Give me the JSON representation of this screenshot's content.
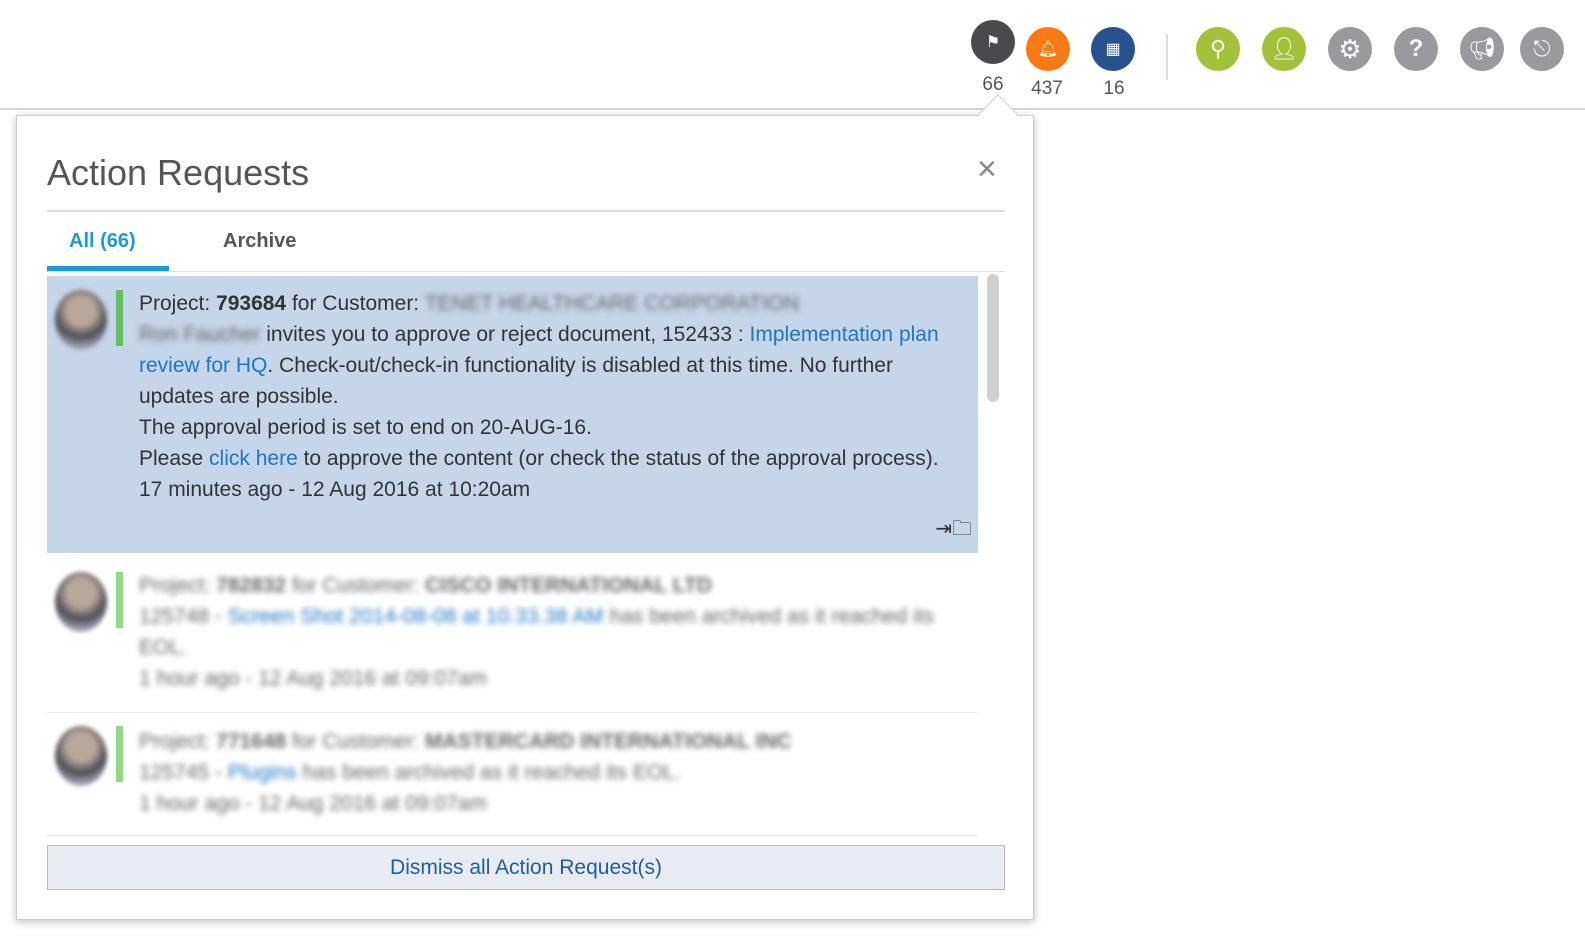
{
  "header": {
    "icons": [
      {
        "name": "flag",
        "color": "#4a4a4e",
        "count": "66"
      },
      {
        "name": "bell",
        "color": "#f97a12",
        "count": "437"
      },
      {
        "name": "calendar",
        "color": "#27518f",
        "count": "16"
      },
      {
        "name": "search",
        "color": "#a4c13a"
      },
      {
        "name": "user",
        "color": "#a4c13a"
      },
      {
        "name": "gear",
        "color": "#9a9a9e"
      },
      {
        "name": "help",
        "color": "#9a9a9e"
      },
      {
        "name": "megaphone",
        "color": "#9a9a9e"
      },
      {
        "name": "logout",
        "color": "#9a9a9e"
      }
    ]
  },
  "panel": {
    "title": "Action Requests",
    "close": "×",
    "tabs": [
      "All (66)",
      "Archive"
    ],
    "dismiss": "Dismiss all Action Request(s)"
  },
  "items": [
    {
      "p1": "Project: ",
      "project": "793684",
      "p2": " for Customer: ",
      "customer": "TENET HEALTHCARE CORPORATION",
      "user": "Ron Faucher",
      "t1": " invites you to approve or reject document, 152433 : ",
      "link1": "Implementation plan review for HQ",
      "t2": ". Check-out/check-in functionality is disabled at this time. No further updates are possible.",
      "t3": "The approval period is set to end on 20-AUG-16.",
      "t4a": "Please ",
      "link2": "click here",
      "t4b": " to approve the content (or check the status of the approval process).",
      "time": "17 minutes ago - 12 Aug 2016 at 10:20am"
    },
    {
      "p1": "Project: ",
      "project": "782832",
      "p2": " for Customer: ",
      "customer": "CISCO INTERNATIONAL LTD",
      "t0": "125748 - ",
      "link1": "Screen Shot 2014-08-08 at 10.33.38 AM",
      "t1": " has been archived as it reached its EOL.",
      "time": "1 hour ago - 12 Aug 2016 at 09:07am"
    },
    {
      "p1": "Project: ",
      "project": "771648",
      "p2": " for Customer: ",
      "customer": "MASTERCARD INTERNATIONAL INC",
      "t0": "125745 - ",
      "link1": "Plugins",
      "t1": " has been archived as it reached its EOL.",
      "time": "1 hour ago - 12 Aug 2016 at 09:07am"
    }
  ]
}
